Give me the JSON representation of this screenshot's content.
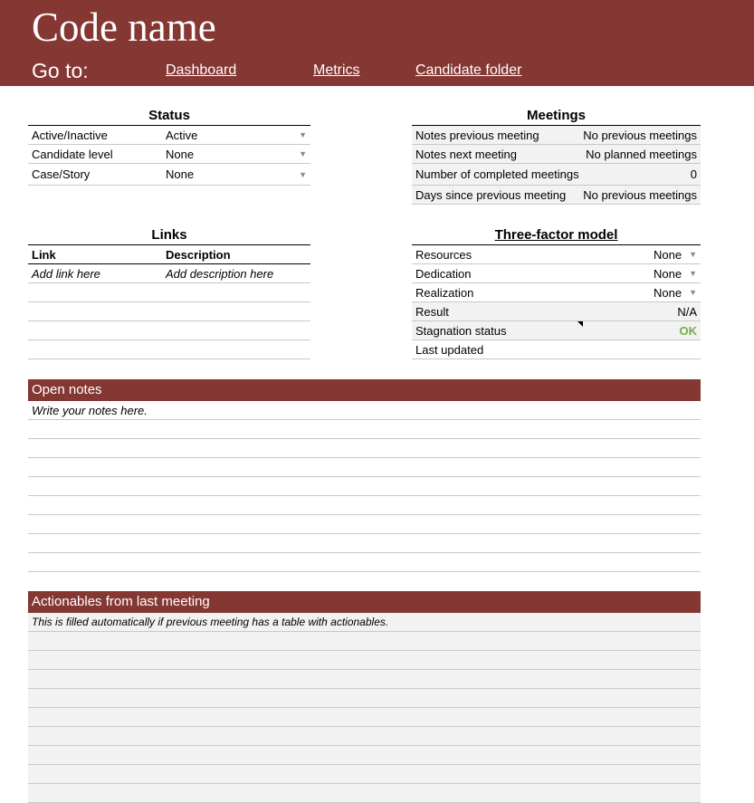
{
  "header": {
    "title": "Code name",
    "goto": "Go to:",
    "links": [
      "Dashboard",
      "Metrics",
      "Candidate folder"
    ]
  },
  "status": {
    "title": "Status",
    "rows": [
      {
        "label": "Active/Inactive",
        "value": "Active"
      },
      {
        "label": "Candidate level",
        "value": "None"
      },
      {
        "label": "Case/Story",
        "value": "None"
      }
    ]
  },
  "meetings": {
    "title": "Meetings",
    "rows": [
      {
        "label": "Notes previous meeting",
        "value": "No previous meetings"
      },
      {
        "label": "Notes next meeting",
        "value": "No planned meetings"
      },
      {
        "label": "Number of completed meetings",
        "value": "0"
      },
      {
        "label": "Days since previous meeting",
        "value": "No previous meetings"
      }
    ]
  },
  "links": {
    "title": "Links",
    "col_link": "Link",
    "col_desc": "Description",
    "placeholder_link": "Add link here",
    "placeholder_desc": "Add description here"
  },
  "three_factor": {
    "title": "Three-factor model",
    "rows": [
      {
        "label": "Resources",
        "value": "None"
      },
      {
        "label": "Dedication",
        "value": "None"
      },
      {
        "label": "Realization",
        "value": "None"
      },
      {
        "label": "Result",
        "value": "N/A"
      },
      {
        "label": "Stagnation status",
        "value": "OK"
      },
      {
        "label": "Last updated",
        "value": ""
      }
    ],
    "ok_color": "#70ad47"
  },
  "open_notes": {
    "title": "Open notes",
    "placeholder": "Write your notes here."
  },
  "actionables": {
    "title": "Actionables from last meeting",
    "text": "This is filled automatically if previous meeting has a table with actionables."
  }
}
